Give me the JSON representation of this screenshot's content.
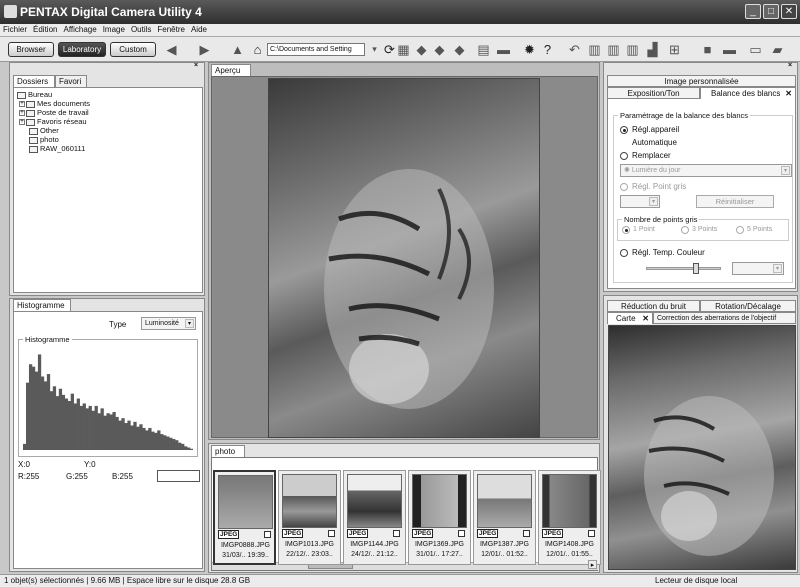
{
  "window": {
    "title": "PENTAX Digital Camera Utility 4",
    "min": "_",
    "max": "□",
    "close": "✕"
  },
  "menu": [
    "Fichier",
    "Édition",
    "Affichage",
    "Image",
    "Outils",
    "Fenêtre",
    "Aide"
  ],
  "toolbar": {
    "modes": [
      "Browser",
      "Laboratory",
      "Custom"
    ],
    "path": "C:\\Documents and Setting"
  },
  "left_tabs": {
    "dossiers": "Dossiers",
    "favori": "Favori",
    "close": "✕"
  },
  "tree": [
    {
      "label": "Bureau",
      "level": 0
    },
    {
      "label": "Mes documents",
      "level": 1
    },
    {
      "label": "Poste de travail",
      "level": 1
    },
    {
      "label": "Favoris réseau",
      "level": 1
    },
    {
      "label": "Other",
      "level": 1
    },
    {
      "label": "photo",
      "level": 1
    },
    {
      "label": "RAW_060111",
      "level": 1
    }
  ],
  "histogram": {
    "tab": "Histogramme",
    "type_label": "Type",
    "type_value": "Luminosité",
    "group_label": "Histogramme",
    "x": "X:0",
    "y": "Y:0",
    "r": "R:255",
    "g": "G:255",
    "b": "B:255",
    "bins": [
      5,
      55,
      70,
      68,
      64,
      78,
      60,
      56,
      62,
      48,
      52,
      44,
      50,
      45,
      42,
      40,
      46,
      38,
      42,
      36,
      38,
      34,
      36,
      32,
      36,
      30,
      34,
      28,
      30,
      29,
      31,
      27,
      24,
      26,
      22,
      24,
      20,
      23,
      19,
      21,
      18,
      16,
      18,
      15,
      14,
      16,
      13,
      12,
      11,
      10,
      9,
      8,
      6,
      5,
      3,
      2,
      1
    ]
  },
  "preview": {
    "tab": "Aperçu"
  },
  "photo_panel": {
    "tab": "photo"
  },
  "thumbnails": [
    {
      "name": "IMGP0888.JPG",
      "date": "31/03/..  19:39..",
      "badge": "JPEG"
    },
    {
      "name": "IMGP1013.JPG",
      "date": "22/12/..  23:03..",
      "badge": "JPEG"
    },
    {
      "name": "IMGP1144.JPG",
      "date": "24/12/..  21:12..",
      "badge": "JPEG"
    },
    {
      "name": "IMGP1369.JPG",
      "date": "31/01/..  17:27..",
      "badge": "JPEG"
    },
    {
      "name": "IMGP1387.JPG",
      "date": "12/01/..  01:52..",
      "badge": "JPEG"
    },
    {
      "name": "IMGP1408.JPG",
      "date": "12/01/..  01:55..",
      "badge": "JPEG"
    }
  ],
  "right_panel": {
    "top_tab": "Image personnalisée",
    "tabs": [
      "Exposition/Ton",
      "Balance des blancs"
    ],
    "group_title": "Paramétrage de la balance des blancs",
    "opt_camera": "Régl.appareil",
    "auto": "Automatique",
    "opt_replace": "Remplacer",
    "replace_value": "Lumière du jour",
    "opt_grey": "Régl. Point gris",
    "reset": "Réinitialiser",
    "points_label": "Nombre de points gris",
    "points": [
      "1 Point",
      "3 Points",
      "5 Points"
    ],
    "opt_temp": "Régl. Temp. Couleur",
    "slider_value": 0.65
  },
  "lower_right": {
    "tabs_top": [
      "Réduction du bruit",
      "Rotation/Décalage"
    ],
    "tab_carte": "Carte",
    "tab_aberr": "Correction des aberrations de l'objectif"
  },
  "status": {
    "left": "1 objet(s) sélectionnés | 9.66 MB | Espace libre sur le disque 28.8 GB",
    "right": "Lecteur de disque local"
  }
}
